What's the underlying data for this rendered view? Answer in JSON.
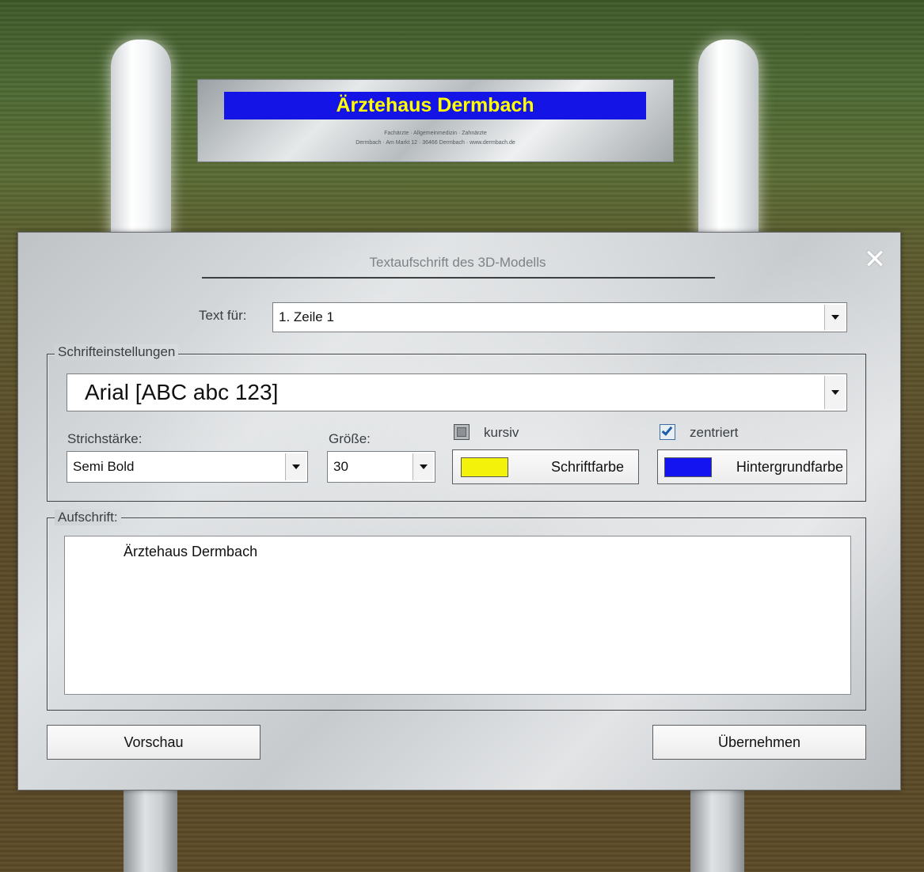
{
  "scene": {
    "sign_title": "Ärztehaus Dermbach",
    "sign_line1": "Fachärzte · Allgemeinmedizin · Zahnärzte",
    "sign_line2": "Dermbach · Am Markt 12 · 36466 Dermbach · www.dermbach.de"
  },
  "dialog": {
    "title": "Textaufschrift des 3D-Modells",
    "close_symbol": "✕",
    "text_for_label": "Text für:",
    "text_for_value": "1. Zeile 1",
    "font_group_label": "Schrifteinstellungen",
    "font_value": "Arial  [ABC abc 123]",
    "weight_label": "Strichstärke:",
    "weight_value": "Semi Bold",
    "size_label": "Größe:",
    "size_value": "30",
    "italic_label": "kursiv",
    "italic_checked": false,
    "centered_label": "zentriert",
    "centered_checked": true,
    "font_color_button": "Schriftfarbe",
    "font_color": "#f2f20a",
    "bg_color_button": "Hintergrundfarbe",
    "bg_color": "#1414f0",
    "inscription_group_label": "Aufschrift:",
    "inscription_text": "Ärztehaus Dermbach",
    "preview_button": "Vorschau",
    "apply_button": "Übernehmen"
  }
}
